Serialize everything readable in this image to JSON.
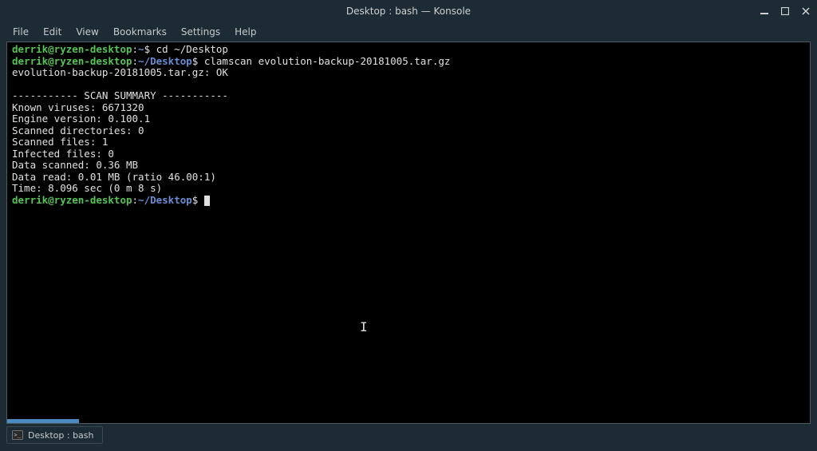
{
  "window": {
    "title": "Desktop : bash — Konsole"
  },
  "menu": {
    "file": "File",
    "edit": "Edit",
    "view": "View",
    "bookmarks": "Bookmarks",
    "settings": "Settings",
    "help": "Help"
  },
  "terminal": {
    "prompt_user": "derrik@ryzen-desktop",
    "home_path": "~",
    "desktop_path": "~/Desktop",
    "dollar": "$",
    "colon": ":",
    "cmd1": "cd ~/Desktop",
    "cmd2": "clamscan evolution-backup-20181005.tar.gz",
    "out_ok": "evolution-backup-20181005.tar.gz: OK",
    "blank": "",
    "sep": "----------- SCAN SUMMARY -----------",
    "s1": "Known viruses: 6671320",
    "s2": "Engine version: 0.100.1",
    "s3": "Scanned directories: 0",
    "s4": "Scanned files: 1",
    "s5": "Infected files: 0",
    "s6": "Data scanned: 0.36 MB",
    "s7": "Data read: 0.01 MB (ratio 46.00:1)",
    "s8": "Time: 8.096 sec (0 m 8 s)"
  },
  "tab": {
    "label": "Desktop : bash"
  }
}
